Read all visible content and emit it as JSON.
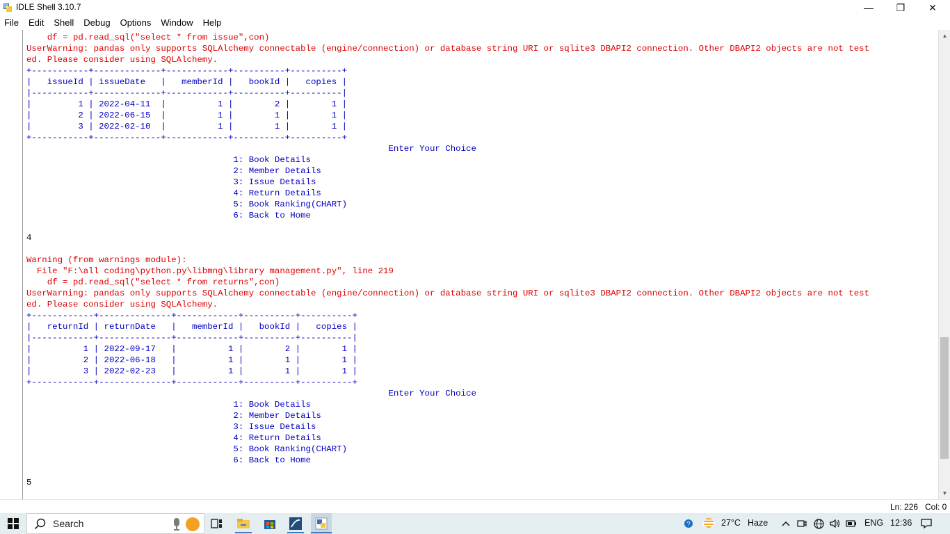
{
  "window": {
    "title": "IDLE Shell 3.10.7",
    "controls": {
      "minimize": "—",
      "maximize": "❐",
      "close": "✕"
    }
  },
  "menu": [
    "File",
    "Edit",
    "Shell",
    "Debug",
    "Options",
    "Window",
    "Help"
  ],
  "shell_lines": [
    {
      "cls": "warn",
      "text": "    df = pd.read_sql(\"select * from issue\",con)"
    },
    {
      "cls": "warn",
      "text": "UserWarning: pandas only supports SQLAlchemy connectable (engine/connection) or database string URI or sqlite3 DBAPI2 connection. Other DBAPI2 objects are not test"
    },
    {
      "cls": "warn",
      "text": "ed. Please consider using SQLAlchemy."
    },
    {
      "cls": "out",
      "text": "+-----------+-------------+------------+----------+----------+"
    },
    {
      "cls": "out",
      "text": "|   issueId | issueDate   |   memberId |   bookId |   copies |"
    },
    {
      "cls": "out",
      "text": "|-----------+-------------+------------+----------+----------|"
    },
    {
      "cls": "out",
      "text": "|         1 | 2022-04-11  |          1 |        2 |        1 |"
    },
    {
      "cls": "out",
      "text": "|         2 | 2022-06-15  |          1 |        1 |        1 |"
    },
    {
      "cls": "out",
      "text": "|         3 | 2022-02-10  |          1 |        1 |        1 |"
    },
    {
      "cls": "out",
      "text": "+-----------+-------------+------------+----------+----------+"
    },
    {
      "cls": "out",
      "text": "                                                                      Enter Your Choice"
    },
    {
      "cls": "out",
      "text": "                                        1: Book Details"
    },
    {
      "cls": "out",
      "text": "                                        2: Member Details"
    },
    {
      "cls": "out",
      "text": "                                        3: Issue Details"
    },
    {
      "cls": "out",
      "text": "                                        4: Return Details"
    },
    {
      "cls": "out",
      "text": "                                        5: Book Ranking(CHART)"
    },
    {
      "cls": "out",
      "text": "                                        6: Back to Home"
    },
    {
      "cls": "out",
      "text": ""
    },
    {
      "cls": "input",
      "text": "4"
    },
    {
      "cls": "out",
      "text": ""
    },
    {
      "cls": "warn",
      "text": "Warning (from warnings module):"
    },
    {
      "cls": "warn",
      "text": "  File \"F:\\all coding\\python.py\\libmng\\library management.py\", line 219"
    },
    {
      "cls": "warn",
      "text": "    df = pd.read_sql(\"select * from returns\",con)"
    },
    {
      "cls": "warn",
      "text": "UserWarning: pandas only supports SQLAlchemy connectable (engine/connection) or database string URI or sqlite3 DBAPI2 connection. Other DBAPI2 objects are not test"
    },
    {
      "cls": "warn",
      "text": "ed. Please consider using SQLAlchemy."
    },
    {
      "cls": "out",
      "text": "+------------+--------------+------------+----------+----------+"
    },
    {
      "cls": "out",
      "text": "|   returnId | returnDate   |   memberId |   bookId |   copies |"
    },
    {
      "cls": "out",
      "text": "|------------+--------------+------------+----------+----------|"
    },
    {
      "cls": "out",
      "text": "|          1 | 2022-09-17   |          1 |        2 |        1 |"
    },
    {
      "cls": "out",
      "text": "|          2 | 2022-06-18   |          1 |        1 |        1 |"
    },
    {
      "cls": "out",
      "text": "|          3 | 2022-02-23   |          1 |        1 |        1 |"
    },
    {
      "cls": "out",
      "text": "+------------+--------------+------------+----------+----------+"
    },
    {
      "cls": "out",
      "text": "                                                                      Enter Your Choice"
    },
    {
      "cls": "out",
      "text": "                                        1: Book Details"
    },
    {
      "cls": "out",
      "text": "                                        2: Member Details"
    },
    {
      "cls": "out",
      "text": "                                        3: Issue Details"
    },
    {
      "cls": "out",
      "text": "                                        4: Return Details"
    },
    {
      "cls": "out",
      "text": "                                        5: Book Ranking(CHART)"
    },
    {
      "cls": "out",
      "text": "                                        6: Back to Home"
    },
    {
      "cls": "out",
      "text": ""
    },
    {
      "cls": "input",
      "text": "5"
    }
  ],
  "status": {
    "ln": "Ln: 226",
    "col": "Col: 0"
  },
  "taskbar": {
    "search_placeholder": "Search",
    "pinned_icons": [
      "task-view-icon",
      "file-explorer-icon",
      "store-icon",
      "sql-app-icon",
      "python-idle-icon"
    ],
    "weather": {
      "temp": "27°C",
      "condition": "Haze"
    },
    "language": "ENG",
    "time": "12:36"
  },
  "colors": {
    "stdout": "#0000c0",
    "stderr": "#dd0000",
    "input": "#000000",
    "taskbar_bg": "#e4eef0"
  }
}
